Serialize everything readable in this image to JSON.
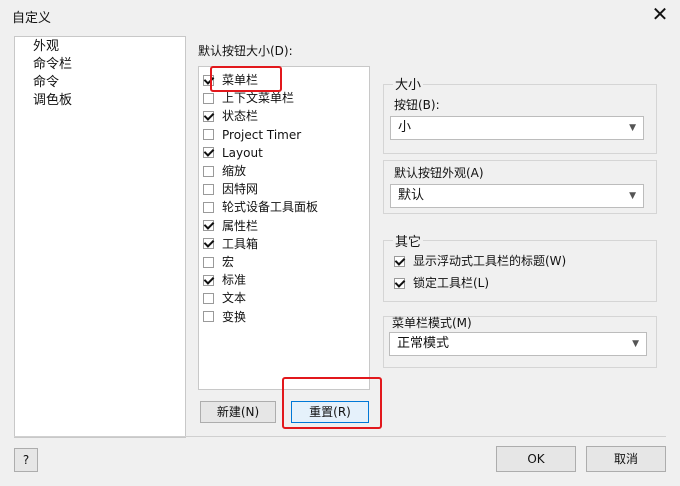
{
  "window": {
    "title": "自定义",
    "close_glyph": "✕"
  },
  "nav": {
    "items": [
      "外观",
      "命令栏",
      "命令",
      "调色板"
    ],
    "selected": "命令栏"
  },
  "toolbar_list": {
    "section_label": "默认按钮大小(D):",
    "items": [
      {
        "label": "菜单栏",
        "checked": true
      },
      {
        "label": "上下文菜单栏",
        "checked": false
      },
      {
        "label": "状态栏",
        "checked": true
      },
      {
        "label": "Project Timer",
        "checked": false
      },
      {
        "label": "Layout",
        "checked": true
      },
      {
        "label": "缩放",
        "checked": false
      },
      {
        "label": "因特网",
        "checked": false
      },
      {
        "label": "轮式设备工具面板",
        "checked": false
      },
      {
        "label": "属性栏",
        "checked": true
      },
      {
        "label": "工具箱",
        "checked": true
      },
      {
        "label": "宏",
        "checked": false
      },
      {
        "label": "标准",
        "checked": true
      },
      {
        "label": "文本",
        "checked": false
      },
      {
        "label": "变换",
        "checked": false
      }
    ],
    "new_button": "新建(N)",
    "reset_button": "重置(R)"
  },
  "size_group": {
    "title": "大小",
    "button_label": "按钮(B):",
    "button_value": "小"
  },
  "appearance": {
    "label": "默认按钮外观(A)",
    "value": "默认"
  },
  "other_group": {
    "title": "其它",
    "options": [
      {
        "label": "显示浮动式工具栏的标题(W)",
        "checked": true
      },
      {
        "label": "锁定工具栏(L)",
        "checked": true
      }
    ]
  },
  "menubar_mode": {
    "label": "菜单栏模式(M)",
    "value": "正常模式"
  },
  "footer": {
    "help": "?",
    "ok": "OK",
    "cancel": "取消"
  },
  "highlight_color": "#e2181c"
}
